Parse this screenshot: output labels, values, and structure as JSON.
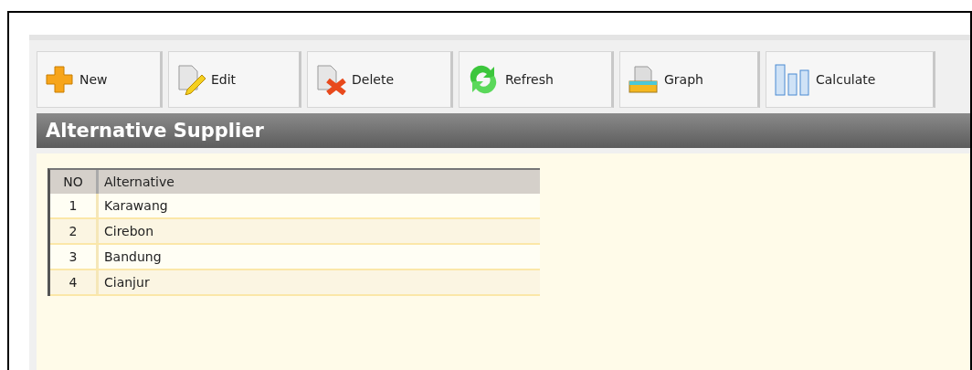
{
  "toolbar": [
    {
      "kind": "new",
      "label": "New"
    },
    {
      "kind": "edit",
      "label": "Edit"
    },
    {
      "kind": "delete",
      "label": "Delete"
    },
    {
      "kind": "refresh",
      "label": "Refresh"
    },
    {
      "kind": "graph",
      "label": "Graph"
    },
    {
      "kind": "calculate",
      "label": "Calculate"
    }
  ],
  "panel": {
    "title": "Alternative Supplier"
  },
  "table": {
    "columns": [
      "NO",
      "Alternative"
    ],
    "rows": [
      [
        "1",
        "Karawang"
      ],
      [
        "2",
        "Cirebon"
      ],
      [
        "3",
        "Bandung"
      ],
      [
        "4",
        "Cianjur"
      ]
    ]
  }
}
